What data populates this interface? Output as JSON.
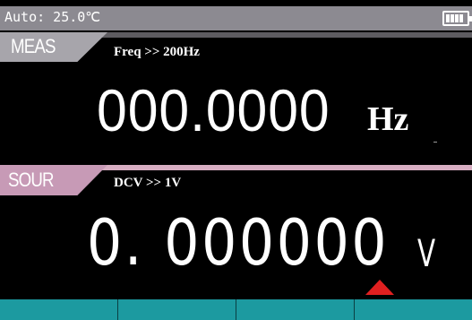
{
  "status": {
    "mode_text": "Auto: 25.0℃",
    "battery_level": 1.0,
    "battery_icon": "battery-full-icon"
  },
  "measure": {
    "tab_label": "MEAS",
    "function": "Freq >> 200Hz",
    "value": "000.0000",
    "unit": "Hz"
  },
  "source": {
    "tab_label": "SOUR",
    "function": "DCV >> 1V",
    "value": "0. 000000",
    "unit": "V"
  },
  "cursor": {
    "icon": "digit-cursor-arrow-icon",
    "color": "#e02020"
  },
  "softkeys": [
    {
      "label": ""
    },
    {
      "label": ""
    },
    {
      "label": ""
    },
    {
      "label": ""
    }
  ],
  "colors": {
    "meas_accent": "#a7a5ab",
    "sour_accent": "#c79ab6",
    "softkey_bar": "#1c9aa0",
    "status_bar": "#8c8a91"
  }
}
